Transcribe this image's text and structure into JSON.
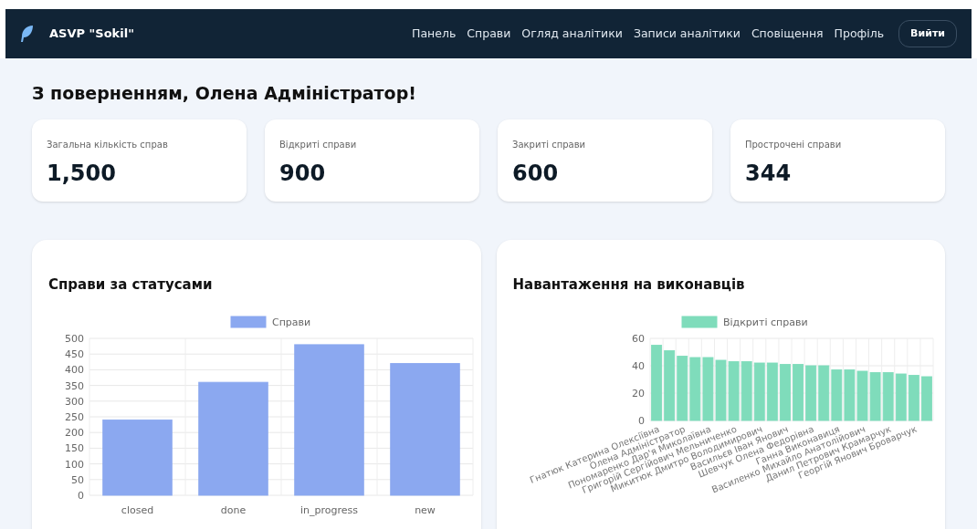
{
  "brand": {
    "name": "ASVP \"Sokil\""
  },
  "nav": {
    "links": [
      "Панель",
      "Справи",
      "Огляд аналітики",
      "Записи аналітики",
      "Сповіщення",
      "Профіль"
    ],
    "logout": "Вийти"
  },
  "greeting": "З поверненням, Олена Адміністратор!",
  "stats": [
    {
      "label": "Загальна кількість справ",
      "value": "1,500"
    },
    {
      "label": "Відкриті справи",
      "value": "900"
    },
    {
      "label": "Закриті справи",
      "value": "600"
    },
    {
      "label": "Прострочені справи",
      "value": "344"
    }
  ],
  "charts": [
    {
      "title": "Справи за статусами",
      "chart_data": {
        "type": "bar",
        "grid": true,
        "categories": [
          "closed",
          "done",
          "in_progress",
          "new"
        ],
        "series": [
          {
            "name": "Справи",
            "color": "#8ba8f0",
            "values": [
              240,
              360,
              480,
              420
            ]
          }
        ],
        "ylim": [
          0,
          500
        ],
        "yticks": [
          0,
          50,
          100,
          150,
          200,
          250,
          300,
          350,
          400,
          450,
          500
        ]
      }
    },
    {
      "title": "Навантаження на виконавців",
      "chart_data": {
        "type": "bar",
        "grid": true,
        "categories": [
          "Гнатюк Катерина Олексіївна",
          null,
          "Олена Адміністратор",
          null,
          "Пономаренко Дар'я Миколаївна",
          null,
          "Григорій Сергійович Мельниченко",
          null,
          "Микитюк Дмитро Володимирович",
          null,
          "Васильєв Іван Янович",
          null,
          "Шевчук Олена Федорівна",
          null,
          "Ганна Виконавиця",
          null,
          "Василенко Михайло Анатолійович",
          null,
          "Данил Петрович Крамарчук",
          null,
          "Георгій Янович Броварчук",
          null
        ],
        "series": [
          {
            "name": "Відкриті справи",
            "color": "#7fdcbb",
            "values": [
              55,
              51,
              47,
              46,
              46,
              44,
              43,
              43,
              42,
              42,
              41,
              41,
              40,
              40,
              37,
              37,
              36,
              35,
              35,
              34,
              33,
              32
            ]
          }
        ],
        "ylim": [
          0,
          60
        ],
        "yticks": [
          0,
          20,
          40,
          60
        ]
      }
    }
  ]
}
